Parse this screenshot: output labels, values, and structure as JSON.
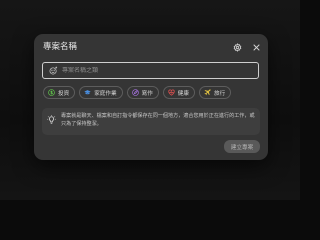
{
  "dialog": {
    "title": "專案名稱",
    "settings_icon": "gear-icon",
    "close_icon": "close-icon"
  },
  "name_field": {
    "placeholder": "專案名稱之類",
    "value": "",
    "icon": "emoji-smile-icon"
  },
  "categories": [
    {
      "label": "投資",
      "icon": "dollar-circle-icon",
      "color": "#5fbf4b"
    },
    {
      "label": "家庭作業",
      "icon": "graduation-cap-icon",
      "color": "#4a8fe0"
    },
    {
      "label": "寫作",
      "icon": "pen-icon",
      "color": "#a070d8"
    },
    {
      "label": "健康",
      "icon": "heart-pulse-icon",
      "color": "#e05050"
    },
    {
      "label": "旅行",
      "icon": "plane-icon",
      "color": "#e0c040"
    }
  ],
  "info": {
    "icon": "lightbulb-icon",
    "text": "專案就是聊天、檔案和自訂指令都保存在同一個地方，適合您用於正在進行的工作，或只為了保持整潔。"
  },
  "create_button": {
    "label": "建立專案"
  }
}
